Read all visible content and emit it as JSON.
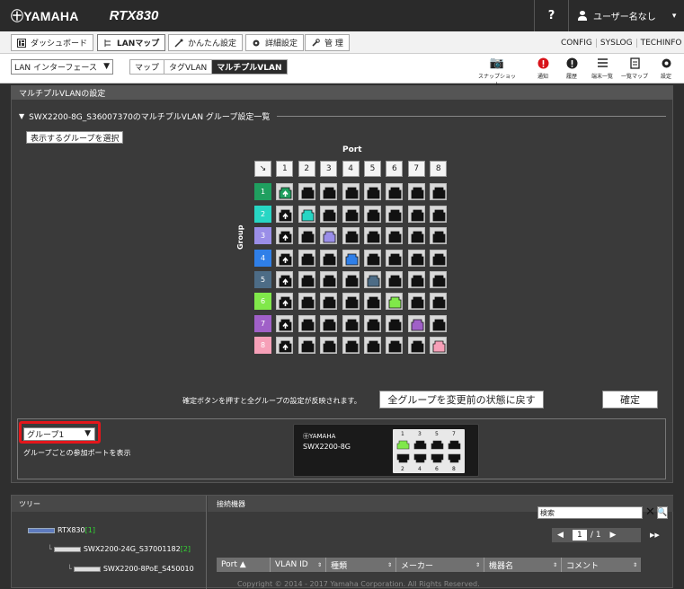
{
  "header": {
    "brand": "㊉YAMAHA",
    "model": "RTX830",
    "help": "?",
    "user": "ユーザー名なし",
    "user_caret": "▾"
  },
  "nav": {
    "tabs": [
      {
        "label": "ダッシュボード",
        "icon": "dashboard-icon"
      },
      {
        "label": "LANマップ",
        "icon": "lanmap-icon",
        "active": true
      },
      {
        "label": "かんたん設定",
        "icon": "wizard-icon"
      },
      {
        "label": "詳細設定",
        "icon": "gear-icon"
      },
      {
        "label": "管 理",
        "icon": "wrench-icon"
      }
    ],
    "links": [
      "CONFIG",
      "SYSLOG",
      "TECHINFO"
    ]
  },
  "subnav": {
    "interface": "LAN インターフェース",
    "tabs": [
      "マップ",
      "タグVLAN",
      "マルチプルVLAN"
    ],
    "selected_tab": "マルチプルVLAN",
    "tools": [
      {
        "label": "スナップショット",
        "icon": "camera-icon"
      },
      {
        "label": "通知",
        "icon": "alert-red-icon"
      },
      {
        "label": "履歴",
        "icon": "alert-icon"
      },
      {
        "label": "端末一覧",
        "icon": "list-icon"
      },
      {
        "label": "一覧マップ",
        "icon": "doc-icon"
      },
      {
        "label": "設定",
        "icon": "gear-icon"
      }
    ]
  },
  "panel": {
    "title": "マルチプルVLANの設定",
    "section": "SWX2200-8G_S36007370のマルチプルVLAN グループ設定一覧",
    "select_groups_button": "表示するグループを選択",
    "port_label": "Port",
    "group_label": "Group",
    "ports": [
      "1",
      "2",
      "3",
      "4",
      "5",
      "6",
      "7",
      "8"
    ],
    "groups": [
      {
        "id": "1",
        "color": "#1f9f5f"
      },
      {
        "id": "2",
        "color": "#27d6c4"
      },
      {
        "id": "3",
        "color": "#9a8ee8"
      },
      {
        "id": "4",
        "color": "#2f7fe8"
      },
      {
        "id": "5",
        "color": "#4d6c86"
      },
      {
        "id": "6",
        "color": "#80e84a"
      },
      {
        "id": "7",
        "color": "#a060c8"
      },
      {
        "id": "8",
        "color": "#f6a0b8"
      }
    ],
    "apply_note": "確定ボタンを押すと全グループの設定が反映されます。",
    "reset_button": "全グループを変更前の状態に戻す",
    "ok_button": "確定",
    "group_select": "グループ1",
    "group_note": "グループごとの参加ポートを表示"
  },
  "switch": {
    "brand": "㊉YAMAHA",
    "model": "SWX2200-8G",
    "top_ports": [
      "1",
      "3",
      "5",
      "7"
    ],
    "bottom_ports": [
      "2",
      "4",
      "6",
      "8"
    ]
  },
  "tree": {
    "title": "ツリー",
    "nodes": [
      {
        "name": "RTX830",
        "count": "[1]"
      },
      {
        "name": "SWX2200-24G_S37001182",
        "count": "[2]"
      },
      {
        "name": "SWX2200-8PoE_S450010",
        "count": ""
      }
    ]
  },
  "connected": {
    "title": "接続機器",
    "search_placeholder": "検索",
    "page": "1",
    "total": "/ 1",
    "columns": [
      "Port ▲",
      "VLAN ID",
      "種類",
      "メーカー",
      "機器名",
      "コメント"
    ]
  },
  "footer": {
    "copyright": "Copyright © 2014 - 2017 Yamaha Corporation. All Rights Reserved."
  }
}
